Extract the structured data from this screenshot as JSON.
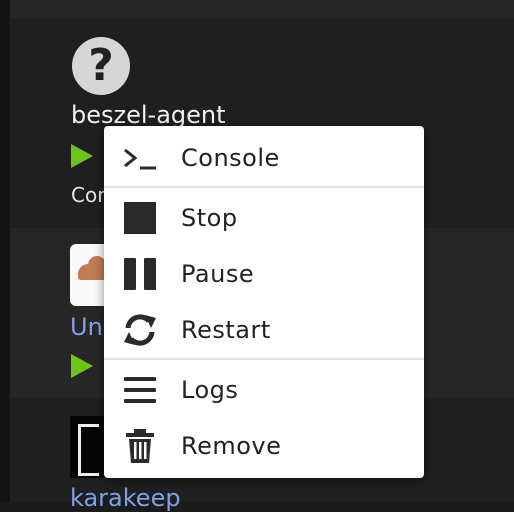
{
  "containers": [
    {
      "name": "beszel-agent",
      "status": "Con"
    },
    {
      "name": "Un"
    },
    {
      "name": "karakeep"
    }
  ],
  "context_menu": {
    "items": [
      {
        "label": "Console",
        "icon": "terminal-icon"
      },
      {
        "label": "Stop",
        "icon": "stop-icon"
      },
      {
        "label": "Pause",
        "icon": "pause-icon"
      },
      {
        "label": "Restart",
        "icon": "restart-icon"
      },
      {
        "label": "Logs",
        "icon": "list-icon"
      },
      {
        "label": "Remove",
        "icon": "trash-icon"
      }
    ]
  },
  "colors": {
    "running": "#6cc51a",
    "link": "#7ea0e6",
    "menu_bg": "#ffffff"
  }
}
